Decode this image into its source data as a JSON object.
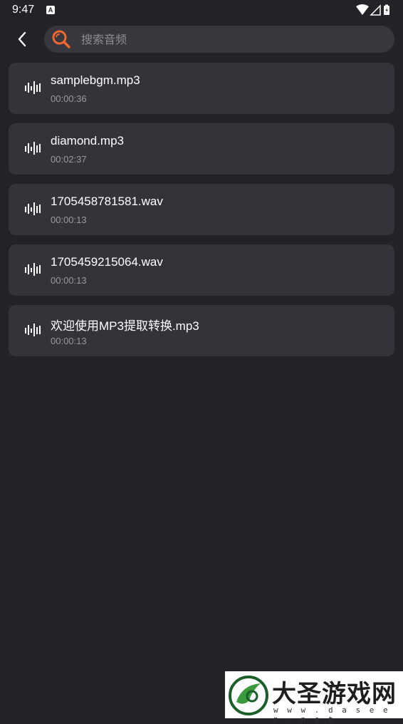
{
  "status_bar": {
    "time": "9:47",
    "notification_icon": "A"
  },
  "search": {
    "placeholder": "搜索音频",
    "value": ""
  },
  "colors": {
    "background": "#232227",
    "card": "#34333a",
    "accent": "#f0672f"
  },
  "files": [
    {
      "name": "samplebgm.mp3",
      "duration": "00:00:36"
    },
    {
      "name": "diamond.mp3",
      "duration": "00:02:37"
    },
    {
      "name": "1705458781581.wav",
      "duration": "00:00:13"
    },
    {
      "name": "1705459215064.wav",
      "duration": "00:00:13"
    },
    {
      "name": "欢迎使用MP3提取转换.mp3",
      "duration": "00:00:13"
    }
  ],
  "watermark": {
    "title": "大圣游戏网",
    "url": "w w w . d a s e e n . n e t"
  }
}
